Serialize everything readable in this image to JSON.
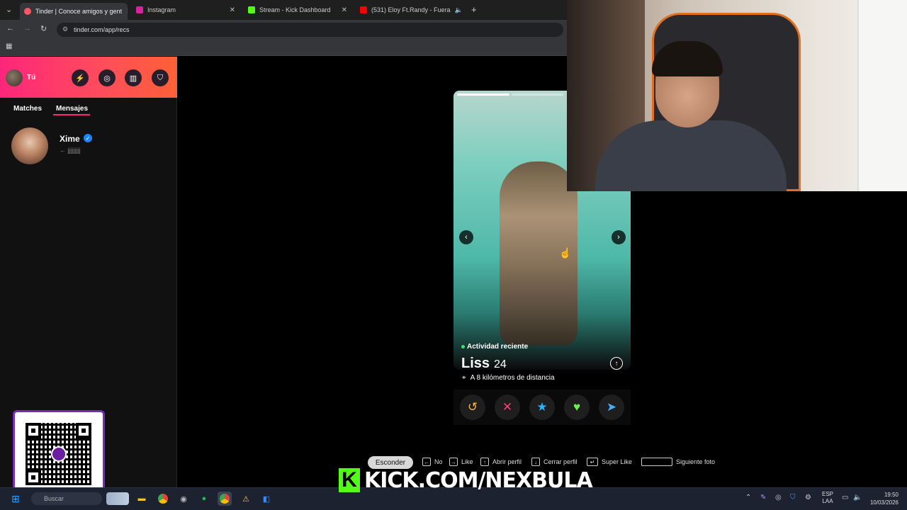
{
  "browser": {
    "tabs": [
      {
        "title": "Tinder | Conoce amigos y gent",
        "favicon_color": "#fd5564"
      },
      {
        "title": "Instagram",
        "favicon_color": "#d6249f"
      },
      {
        "title": "Stream - Kick Dashboard",
        "favicon_color": "#53fc18"
      },
      {
        "title": "(531) Eloy Ft.Randy - Fuera",
        "favicon_color": "#ff0000"
      }
    ],
    "url": "tinder.com/app/recs"
  },
  "sidebar": {
    "user_label": "Tú",
    "subtabs": {
      "matches": "Matches",
      "messages": "Mensajes"
    },
    "conversation": {
      "name": "Xime",
      "preview": "← jjjjjjjjj"
    }
  },
  "card": {
    "activity": "Actividad reciente",
    "name": "Liss",
    "age": "24",
    "distance": "A 8 kilómetros de distancia"
  },
  "hints": {
    "hide": "Esconder",
    "no": "No",
    "like": "Like",
    "open_profile": "Abrir perfil",
    "close_profile": "Cerrar perfil",
    "super_like": "Super Like",
    "next_photo": "Siguiente foto"
  },
  "overlay": {
    "kick_text": "KICK.COM/NEXBULA",
    "kick_color": "#53fc18"
  },
  "taskbar": {
    "search": "Buscar",
    "lang_top": "ESP",
    "lang_bottom": "LAA",
    "time": "19:50",
    "date": "10/03/2026"
  },
  "icons": [
    "back-arrow-icon",
    "forward-arrow-icon",
    "reload-icon",
    "lightning-icon",
    "compass-icon",
    "briefcase-icon",
    "shield-icon",
    "verified-icon",
    "rewind-icon",
    "nope-icon",
    "superlike-icon",
    "like-icon",
    "boost-icon",
    "location-icon",
    "up-arrow-icon"
  ]
}
